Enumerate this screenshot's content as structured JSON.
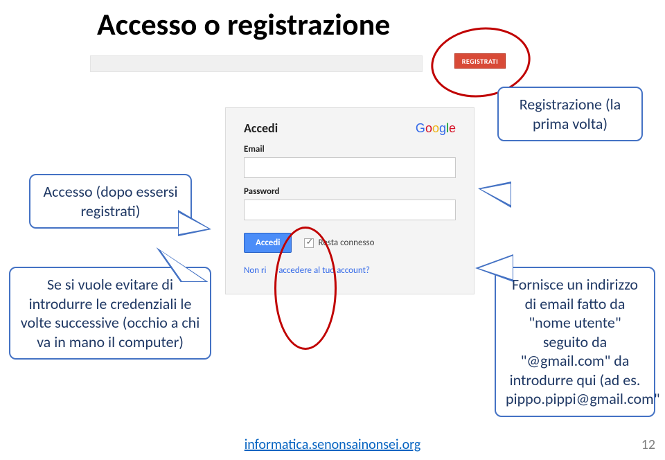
{
  "title": "Accesso o registrazione",
  "topbar": {
    "register_btn": "REGISTRATI"
  },
  "login": {
    "heading": "Accedi",
    "google_letters": [
      "G",
      "o",
      "o",
      "g",
      "l",
      "e"
    ],
    "email_label": "Email",
    "password_label": "Password",
    "signin_btn": "Accedi",
    "remember": "Resta connesso",
    "cant_prefix": "Non ri",
    "cant_rest": "accedere al tuo account?"
  },
  "callouts": {
    "registration": "Registrazione (la prima volta)",
    "access": "Accesso (dopo essersi registrati)",
    "credentials": "Se si vuole evitare di introdurre le credenziali le volte successive (occhio a chi va in mano il computer)",
    "gmail": "Fornisce un indirizzo di email fatto da \"nome utente\" seguito da \"@gmail.com\" da introdurre qui (ad es. pippo.pippi@gmail.com\""
  },
  "footer": {
    "link": "informatica.senonsainonsei.org",
    "page": "12"
  }
}
